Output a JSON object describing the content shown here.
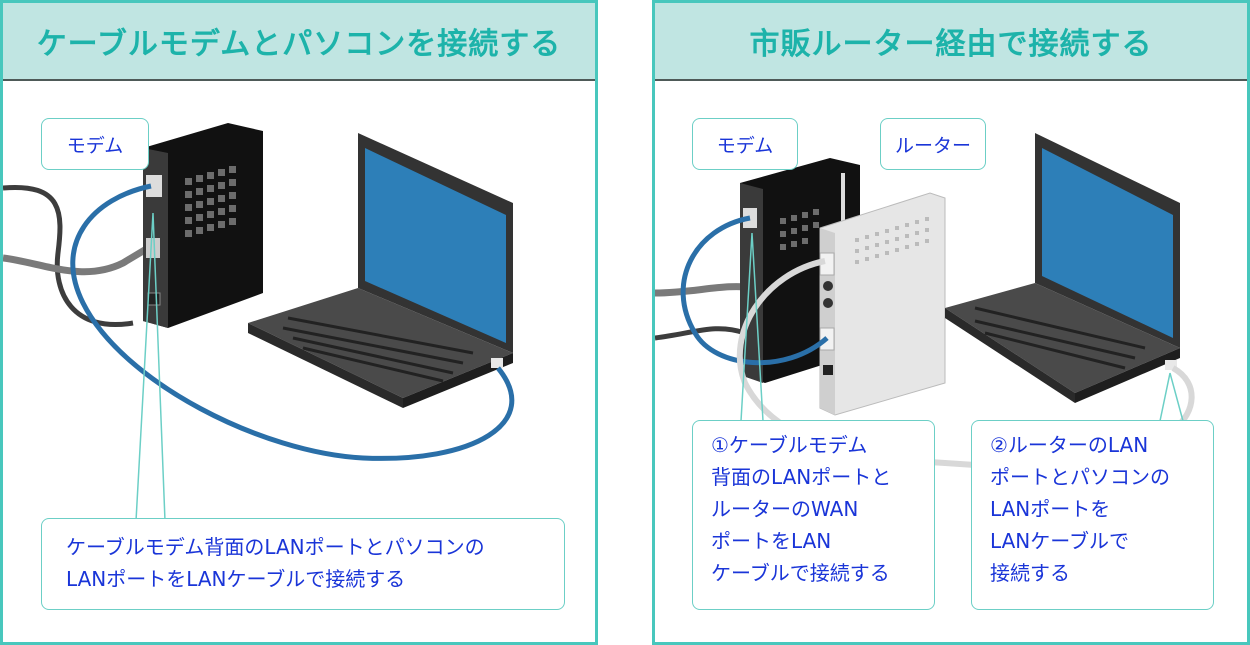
{
  "left_panel": {
    "title": "ケーブルモデムとパソコンを接続する",
    "labels": {
      "modem": "モデム"
    },
    "callout": "ケーブルモデム背面のLANポートとパソコンの\nLANポートをLANケーブルで接続する"
  },
  "right_panel": {
    "title": "市販ルーター経由で接続する",
    "labels": {
      "modem": "モデム",
      "router": "ルーター"
    },
    "callout_1": "①ケーブルモデム\n背面のLANポートと\nルーターのWAN\nポートをLAN\nケーブルで接続する",
    "callout_2": "②ルーターのLAN\nポートとパソコンの\nLANポートを\nLANケーブルで\n接続する"
  },
  "colors": {
    "panel_border": "#48c7bd",
    "header_bg": "#c0e5e2",
    "title_text": "#1db3aa",
    "callout_text": "#1a35d8",
    "lan_cable_blue": "#2a6fa8",
    "screen_blue": "#2d7fb8"
  }
}
